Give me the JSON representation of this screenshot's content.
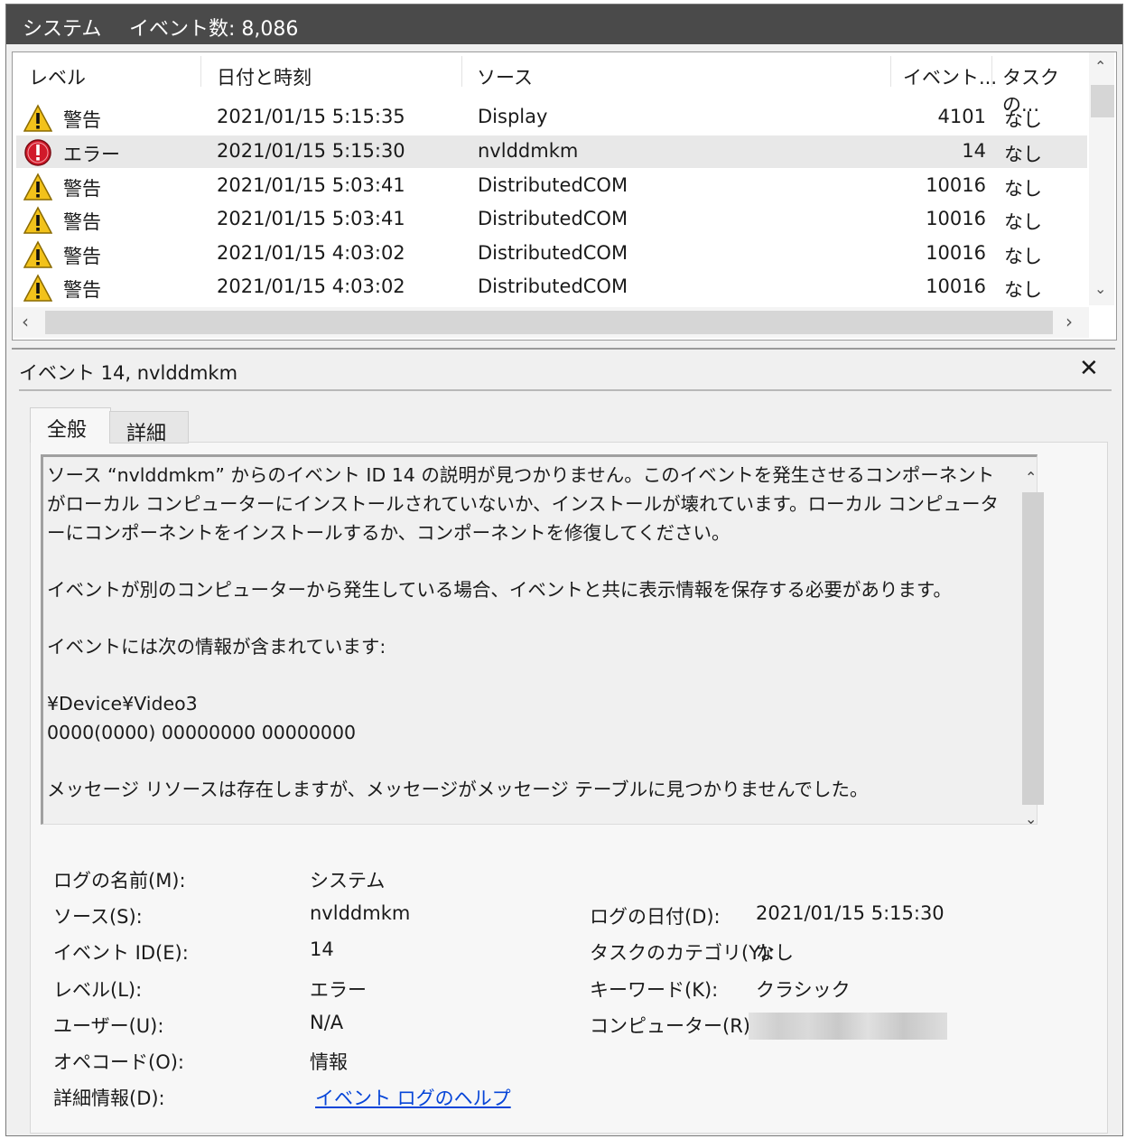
{
  "titlebar": {
    "log_name": "システム",
    "event_count": "イベント数: 8,086"
  },
  "list": {
    "columns": [
      "レベル",
      "日付と時刻",
      "ソース",
      "イベント...",
      "タスクの..."
    ],
    "rows": [
      {
        "icon": "warning-icon",
        "level": "警告",
        "datetime": "2021/01/15 5:15:35",
        "source": "Display",
        "event_id": "4101",
        "task": "なし"
      },
      {
        "icon": "error-icon",
        "level": "エラー",
        "datetime": "2021/01/15 5:15:30",
        "source": "nvlddmkm",
        "event_id": "14",
        "task": "なし"
      },
      {
        "icon": "warning-icon",
        "level": "警告",
        "datetime": "2021/01/15 5:03:41",
        "source": "DistributedCOM",
        "event_id": "10016",
        "task": "なし"
      },
      {
        "icon": "warning-icon",
        "level": "警告",
        "datetime": "2021/01/15 5:03:41",
        "source": "DistributedCOM",
        "event_id": "10016",
        "task": "なし"
      },
      {
        "icon": "warning-icon",
        "level": "警告",
        "datetime": "2021/01/15 4:03:02",
        "source": "DistributedCOM",
        "event_id": "10016",
        "task": "なし"
      },
      {
        "icon": "warning-icon",
        "level": "警告",
        "datetime": "2021/01/15 4:03:02",
        "source": "DistributedCOM",
        "event_id": "10016",
        "task": "なし"
      }
    ]
  },
  "detail": {
    "title": "イベント 14, nvlddmkm",
    "tabs": [
      "全般",
      "詳細"
    ],
    "description": [
      "ソース “nvlddmkm” からのイベント ID 14 の説明が見つかりません。このイベントを発生させるコンポーネントがローカル コンピューターにインストールされていないか、インストールが壊れています。ローカル コンピューターにコンポーネントをインストールするか、コンポーネントを修復してください。",
      "イベントが別のコンピューターから発生している場合、イベントと共に表示情報を保存する必要があります。",
      "イベントには次の情報が含まれています:",
      "¥Device¥Video3",
      "0000(0000) 00000000 00000000",
      "メッセージ リソースは存在しますが、メッセージがメッセージ テーブルに見つかりませんでした。"
    ],
    "props": {
      "log_name_label": "ログの名前(M):",
      "log_name_value": "システム",
      "source_label": "ソース(S):",
      "source_value": "nvlddmkm",
      "event_id_label": "イベント ID(E):",
      "event_id_value": "14",
      "level_label": "レベル(L):",
      "level_value": "エラー",
      "user_label": "ユーザー(U):",
      "user_value": "N/A",
      "opcode_label": "オペコード(O):",
      "opcode_value": "情報",
      "more_info_label": "詳細情報(D):",
      "more_info_link": "イベント ログのヘルプ",
      "logged_label": "ログの日付(D):",
      "logged_value": "2021/01/15 5:15:30",
      "task_cat_label": "タスクのカテゴリ(Y):",
      "task_cat_value": "なし",
      "keywords_label": "キーワード(K):",
      "keywords_value": "クラシック",
      "computer_label": "コンピューター(R):"
    }
  },
  "colors": {
    "titlebar": "#4a4a4a",
    "warning": "#f2c21b",
    "error": "#d11a2a",
    "link": "#0645d8",
    "selected_row": "#e8e8e8"
  }
}
